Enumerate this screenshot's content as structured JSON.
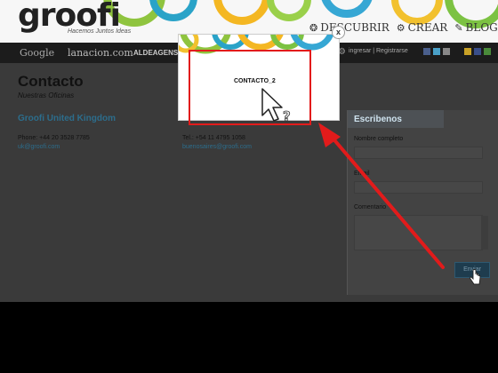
{
  "header": {
    "logo": "groofi",
    "tagline": "Hacemos Juntos Ideas",
    "nav": [
      {
        "icon": "❂",
        "label": "DESCUBRIR"
      },
      {
        "icon": "⚙",
        "label": "CREAR"
      },
      {
        "icon": "✎",
        "label": "BLOG"
      }
    ]
  },
  "partners": {
    "items": [
      "Google",
      "lanacion.com",
      "ALDEAGENS"
    ],
    "login": "ingresar | Registrarse"
  },
  "page": {
    "title": "Contacto",
    "subtitle": "Nuestras Oficinas",
    "offices": [
      {
        "name": "Groofi United Kingdom",
        "phone": "Phone: +44 20 3528 7785",
        "email": "uk@groofi.com"
      },
      {
        "name": "",
        "phone": "Tel.: +54 11 4795 1058",
        "email": "buenosaires@groofi.com"
      }
    ]
  },
  "form": {
    "title": "Escribenos",
    "name_label": "Nombre completo",
    "email_label": "Email",
    "comment_label": "Comentario",
    "send_label": "Enviar"
  },
  "modal": {
    "label": "CONTACTO_2",
    "close": "x"
  },
  "annotation": {
    "color": "#e21b1b",
    "cursor_symbol": "?"
  }
}
